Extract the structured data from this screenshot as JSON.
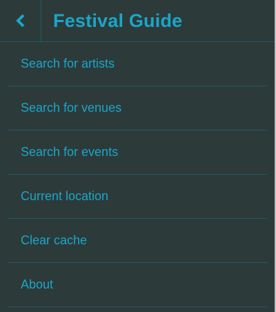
{
  "header": {
    "back_icon": "chevron-left-icon",
    "title": "Festival Guide"
  },
  "menu": {
    "items": [
      {
        "label": "Search for artists"
      },
      {
        "label": "Search for venues"
      },
      {
        "label": "Search for events"
      },
      {
        "label": "Current location"
      },
      {
        "label": "Clear cache"
      },
      {
        "label": "About"
      }
    ]
  },
  "colors": {
    "background": "#2d3a3a",
    "accent": "#1aa6c8",
    "divider": "#1f5a66"
  }
}
